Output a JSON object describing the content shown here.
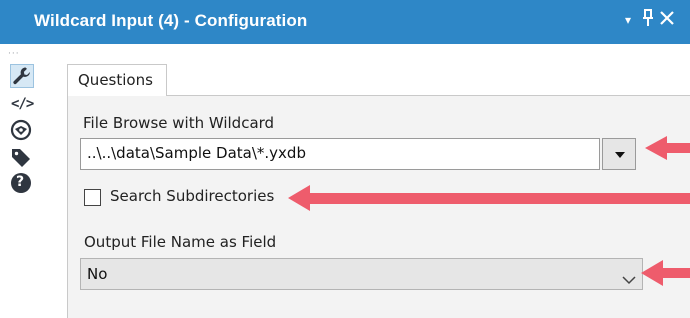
{
  "window": {
    "title": "Wildcard Input (4) - Configuration",
    "controls": {
      "menu": "▾",
      "pin": "Ͱ",
      "close": "✕"
    }
  },
  "sidebar": {
    "items": [
      {
        "name": "wrench-icon"
      },
      {
        "name": "code-icon",
        "glyph": "</>"
      },
      {
        "name": "preview-icon"
      },
      {
        "name": "tag-icon"
      },
      {
        "name": "help-icon",
        "glyph": "?"
      }
    ]
  },
  "tabs": [
    {
      "label": "Questions"
    }
  ],
  "form": {
    "file_browse": {
      "label": "File Browse with Wildcard",
      "value": "..\\..\\data\\Sample Data\\*.yxdb"
    },
    "search_subdirs": {
      "label": "Search Subdirectories",
      "checked": false
    },
    "output_file_name": {
      "label": "Output File Name as Field",
      "selected": "No"
    }
  },
  "colors": {
    "title_bar": "#2e87c7",
    "panel_bg": "#f3f3f3",
    "sidebar_icon": "#2f3640",
    "annotation_arrow": "#ee5c6c"
  }
}
